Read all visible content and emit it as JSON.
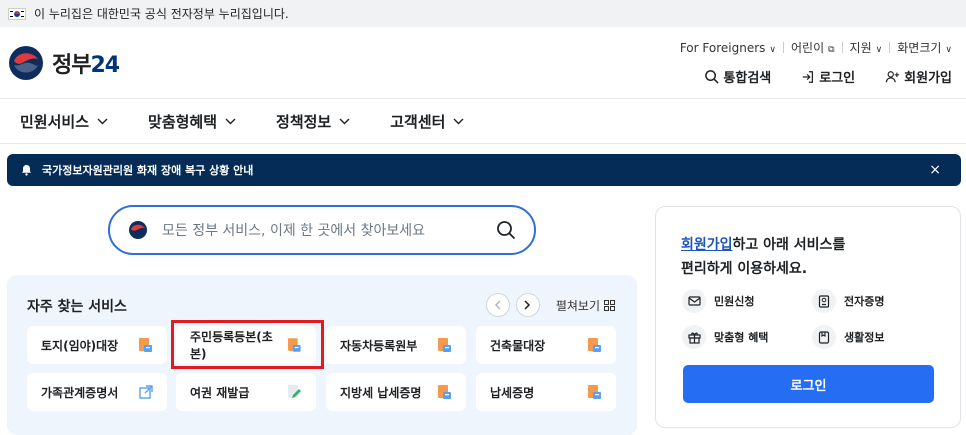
{
  "gov_banner": {
    "text": "이 누리집은 대한민국 공식 전자정부 누리집입니다."
  },
  "logo": {
    "text": "정부",
    "num": "24"
  },
  "util": {
    "foreigners": "For Foreigners",
    "kids": "어린이",
    "support": "지원",
    "zoom": "화면크기"
  },
  "actions": {
    "search": "통합검색",
    "login": "로그인",
    "signup": "회원가입"
  },
  "nav": {
    "items": [
      "민원서비스",
      "맞춤형혜택",
      "정책정보",
      "고객센터"
    ]
  },
  "notice": {
    "text": "국가정보자원관리원 화재 장애 복구 상황 안내",
    "close": "×"
  },
  "search": {
    "placeholder": "모든 정부 서비스, 이제 한 곳에서 찾아보세요"
  },
  "frequent": {
    "title": "자주 찾는 서비스",
    "view_all": "펼쳐보기",
    "items": [
      {
        "label": "토지(임야)대장",
        "icon": "document-print-icon"
      },
      {
        "label": "주민등록등본(초본)",
        "icon": "document-print-icon"
      },
      {
        "label": "자동차등록원부",
        "icon": "document-print-icon"
      },
      {
        "label": "건축물대장",
        "icon": "document-print-icon"
      },
      {
        "label": "가족관계증명서",
        "icon": "external-link-icon"
      },
      {
        "label": "여권 재발급",
        "icon": "document-edit-icon"
      },
      {
        "label": "지방세 납세증명",
        "icon": "document-print-icon"
      },
      {
        "label": "납세증명",
        "icon": "document-print-icon"
      }
    ]
  },
  "login_panel": {
    "link": "회원가입",
    "msg1": "하고 아래 서비스를",
    "msg2": "편리하게 이용하세요.",
    "services": [
      "민원신청",
      "전자증명",
      "맞춤형 혜택",
      "생활정보"
    ],
    "button": "로그인"
  },
  "colors": {
    "accent": "#256ef4",
    "notice_bg": "#052b57",
    "highlight": "#e11b22",
    "link": "#1d56bc"
  }
}
